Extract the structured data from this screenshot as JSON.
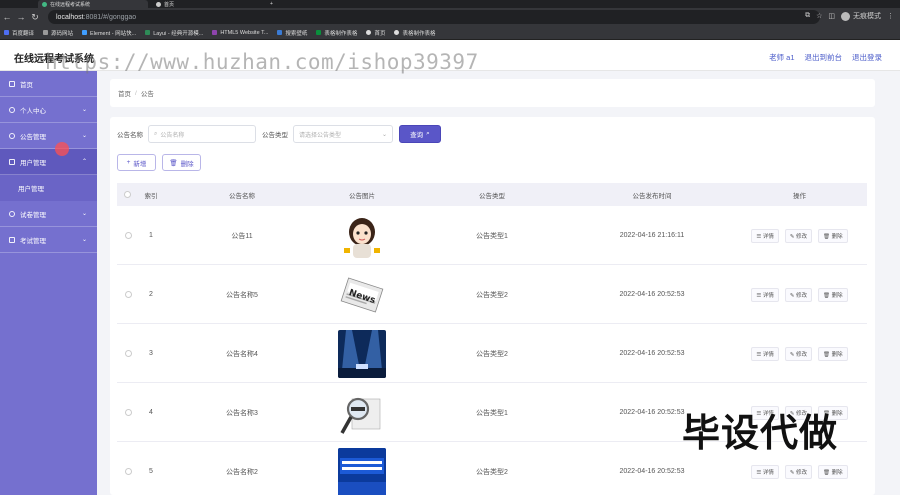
{
  "browser": {
    "tabs": [
      {
        "title": "在线远程考试系统",
        "active": true
      },
      {
        "title": "首页",
        "active": false
      }
    ],
    "new_tab": "+",
    "url_host": "localhost",
    "url_rest": ":8081/#/gonggao",
    "profile_label": "无痕模式",
    "bookmarks": [
      {
        "label": "百度翻译",
        "color": "#4e6ef2"
      },
      {
        "label": "源码网站",
        "color": "#444"
      },
      {
        "label": "Element - 网站快...",
        "color": "#409eff"
      },
      {
        "label": "Layui - 经典开源模...",
        "color": "#2e8b57"
      },
      {
        "label": "HTML5 Website T...",
        "color": "#8e44ad"
      },
      {
        "label": "搜索壁纸",
        "color": "#3a7bd5"
      },
      {
        "label": "表格制作表格",
        "color": "#0a8f3c"
      },
      {
        "label": "首页",
        "color": "#ddd"
      },
      {
        "label": "表格制作表格",
        "color": "#ddd"
      }
    ]
  },
  "header": {
    "title": "在线远程考试系统",
    "links": [
      "老师 a1",
      "退出到前台",
      "退出登录"
    ]
  },
  "watermark": "https://www.huzhan.com/ishop39397",
  "sidebar": {
    "items": [
      {
        "label": "首页",
        "has_children": false
      },
      {
        "label": "个人中心",
        "has_children": true
      },
      {
        "label": "公告管理",
        "has_children": true
      },
      {
        "label": "用户管理",
        "has_children": true,
        "expanded": true
      },
      {
        "label": "试卷管理",
        "has_children": true
      },
      {
        "label": "考试管理",
        "has_children": true
      }
    ],
    "sub_items": [
      "用户管理"
    ]
  },
  "breadcrumb": [
    "首页",
    "公告"
  ],
  "search": {
    "name_label": "公告名称",
    "name_placeholder": "公告名称",
    "type_label": "公告类型",
    "type_placeholder": "请选择公告类型",
    "button": "查询"
  },
  "actions": {
    "add": "新增",
    "delete": "删除"
  },
  "table": {
    "headers": [
      "索引",
      "公告名称",
      "公告图片",
      "公告类型",
      "公告发布时间",
      "操作"
    ],
    "row_ops": [
      "详情",
      "修改",
      "删除"
    ],
    "rows": [
      {
        "index": "1",
        "name": "公告11",
        "image": "cartoon-girl",
        "type": "公告类型1",
        "time": "2022-04-16 21:16:11"
      },
      {
        "index": "2",
        "name": "公告名称5",
        "image": "news-paper",
        "type": "公告类型2",
        "time": "2022-04-16 20:52:53"
      },
      {
        "index": "3",
        "name": "公告名称4",
        "image": "stage-lights",
        "type": "公告类型2",
        "time": "2022-04-16 20:52:53"
      },
      {
        "index": "4",
        "name": "公告名称3",
        "image": "magnifier-news",
        "type": "公告类型1",
        "time": "2022-04-16 20:52:53"
      },
      {
        "index": "5",
        "name": "公告名称2",
        "image": "news-banner",
        "type": "公告类型2",
        "time": "2022-04-16 20:52:53"
      }
    ]
  },
  "stamp": "毕设代做",
  "colors": {
    "sidebar": "#7570cf",
    "primary": "#5a56c8"
  }
}
